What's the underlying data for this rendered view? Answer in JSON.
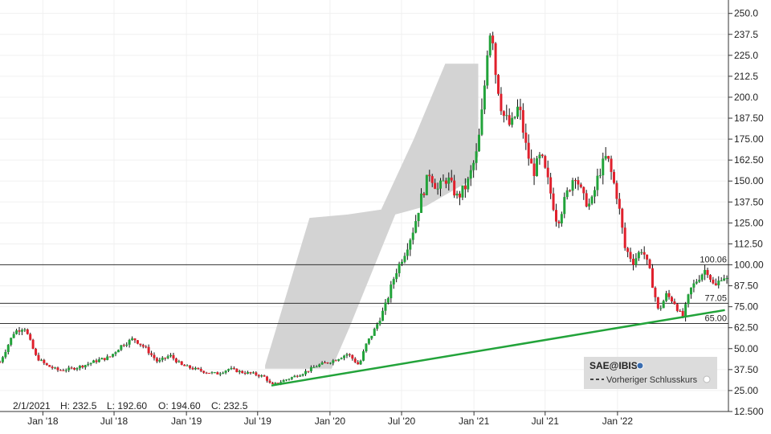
{
  "chart_data": {
    "type": "candlestick",
    "title": "",
    "ylim": [
      12.5,
      258
    ],
    "y_ticks": [
      "250.0",
      "237.5",
      "225.0",
      "212.5",
      "200.0",
      "187.50",
      "175.00",
      "162.50",
      "150.00",
      "137.50",
      "125.00",
      "112.50",
      "100.00",
      "87.50",
      "75.00",
      "62.50",
      "50.00",
      "37.50",
      "25.00",
      "12.500"
    ],
    "x_ticks": [
      {
        "label": "Jan '18",
        "date": "2018-01-01"
      },
      {
        "label": "Jul '18",
        "date": "2018-07-01"
      },
      {
        "label": "Jan '19",
        "date": "2019-01-01"
      },
      {
        "label": "Jul '19",
        "date": "2019-07-01"
      },
      {
        "label": "Jan '20",
        "date": "2020-01-01"
      },
      {
        "label": "Jul '20",
        "date": "2020-07-01"
      },
      {
        "label": "Jan '21",
        "date": "2021-01-01"
      },
      {
        "label": "Jul '21",
        "date": "2021-07-01"
      },
      {
        "label": "Jan '22",
        "date": "2022-01-01"
      }
    ],
    "x_range": [
      "2017-09-14",
      "2022-10-10"
    ],
    "ohlc_readout": {
      "date": "2/1/2021",
      "high": "H: 232.5",
      "low": "L: 192.60",
      "open": "O: 194.60",
      "close": "C: 232.5"
    },
    "levels": [
      {
        "value": 100.06,
        "label": "100.06"
      },
      {
        "value": 77.05,
        "label": "77.05"
      },
      {
        "value": 65.0,
        "label": "65.00"
      }
    ],
    "trendline": {
      "start": {
        "date": "2019-08-05",
        "value": 28
      },
      "end": {
        "date": "2022-10-01",
        "value": 73
      },
      "color": "#22a33a"
    },
    "legend": {
      "title": "SAE@IBIS",
      "entry": "Vorheriger Schlusskurs"
    },
    "colors": {
      "up": "#22a33a",
      "down": "#e0202c",
      "wick": "#111111",
      "band": "#d3d3d3",
      "grid": "#f0f0f0"
    },
    "price_path": [
      [
        "2017-09-14",
        42
      ],
      [
        "2017-10-20",
        60
      ],
      [
        "2017-11-15",
        63
      ],
      [
        "2017-12-15",
        45
      ],
      [
        "2018-01-10",
        40
      ],
      [
        "2018-02-10",
        37
      ],
      [
        "2018-03-15",
        38
      ],
      [
        "2018-04-15",
        40
      ],
      [
        "2018-05-20",
        43
      ],
      [
        "2018-06-20",
        45
      ],
      [
        "2018-07-20",
        52
      ],
      [
        "2018-08-20",
        56
      ],
      [
        "2018-09-20",
        50
      ],
      [
        "2018-10-20",
        42
      ],
      [
        "2018-11-20",
        46
      ],
      [
        "2018-12-20",
        40
      ],
      [
        "2019-01-20",
        38
      ],
      [
        "2019-02-20",
        36
      ],
      [
        "2019-03-20",
        35
      ],
      [
        "2019-04-20",
        38
      ],
      [
        "2019-05-20",
        36
      ],
      [
        "2019-06-20",
        35
      ],
      [
        "2019-07-20",
        33
      ],
      [
        "2019-08-05",
        28
      ],
      [
        "2019-09-05",
        31
      ],
      [
        "2019-10-20",
        35
      ],
      [
        "2019-12-01",
        40
      ],
      [
        "2020-01-10",
        43
      ],
      [
        "2020-02-15",
        47
      ],
      [
        "2020-03-15",
        40
      ],
      [
        "2020-04-01",
        52
      ],
      [
        "2020-04-25",
        62
      ],
      [
        "2020-05-20",
        75
      ],
      [
        "2020-06-15",
        95
      ],
      [
        "2020-07-10",
        108
      ],
      [
        "2020-08-01",
        122
      ],
      [
        "2020-08-20",
        140
      ],
      [
        "2020-09-10",
        155
      ],
      [
        "2020-10-01",
        145
      ],
      [
        "2020-10-25",
        152
      ],
      [
        "2020-11-20",
        140
      ],
      [
        "2020-12-15",
        148
      ],
      [
        "2021-01-10",
        168
      ],
      [
        "2021-01-25",
        198
      ],
      [
        "2021-02-05",
        232
      ],
      [
        "2021-02-15",
        245
      ],
      [
        "2021-02-25",
        215
      ],
      [
        "2021-03-15",
        190
      ],
      [
        "2021-04-05",
        182
      ],
      [
        "2021-04-25",
        195
      ],
      [
        "2021-05-15",
        168
      ],
      [
        "2021-06-01",
        155
      ],
      [
        "2021-06-20",
        165
      ],
      [
        "2021-07-10",
        148
      ],
      [
        "2021-08-01",
        125
      ],
      [
        "2021-08-25",
        142
      ],
      [
        "2021-09-15",
        155
      ],
      [
        "2021-10-05",
        140
      ],
      [
        "2021-10-25",
        135
      ],
      [
        "2021-11-15",
        155
      ],
      [
        "2021-12-05",
        165
      ],
      [
        "2022-01-01",
        140
      ],
      [
        "2022-01-20",
        110
      ],
      [
        "2022-02-10",
        102
      ],
      [
        "2022-03-05",
        110
      ],
      [
        "2022-03-25",
        95
      ],
      [
        "2022-04-15",
        72
      ],
      [
        "2022-05-05",
        82
      ],
      [
        "2022-05-25",
        78
      ],
      [
        "2022-06-15",
        68
      ],
      [
        "2022-07-05",
        85
      ],
      [
        "2022-07-25",
        92
      ],
      [
        "2022-08-15",
        98
      ],
      [
        "2022-09-05",
        86
      ],
      [
        "2022-09-25",
        94
      ],
      [
        "2022-10-10",
        90
      ]
    ]
  }
}
